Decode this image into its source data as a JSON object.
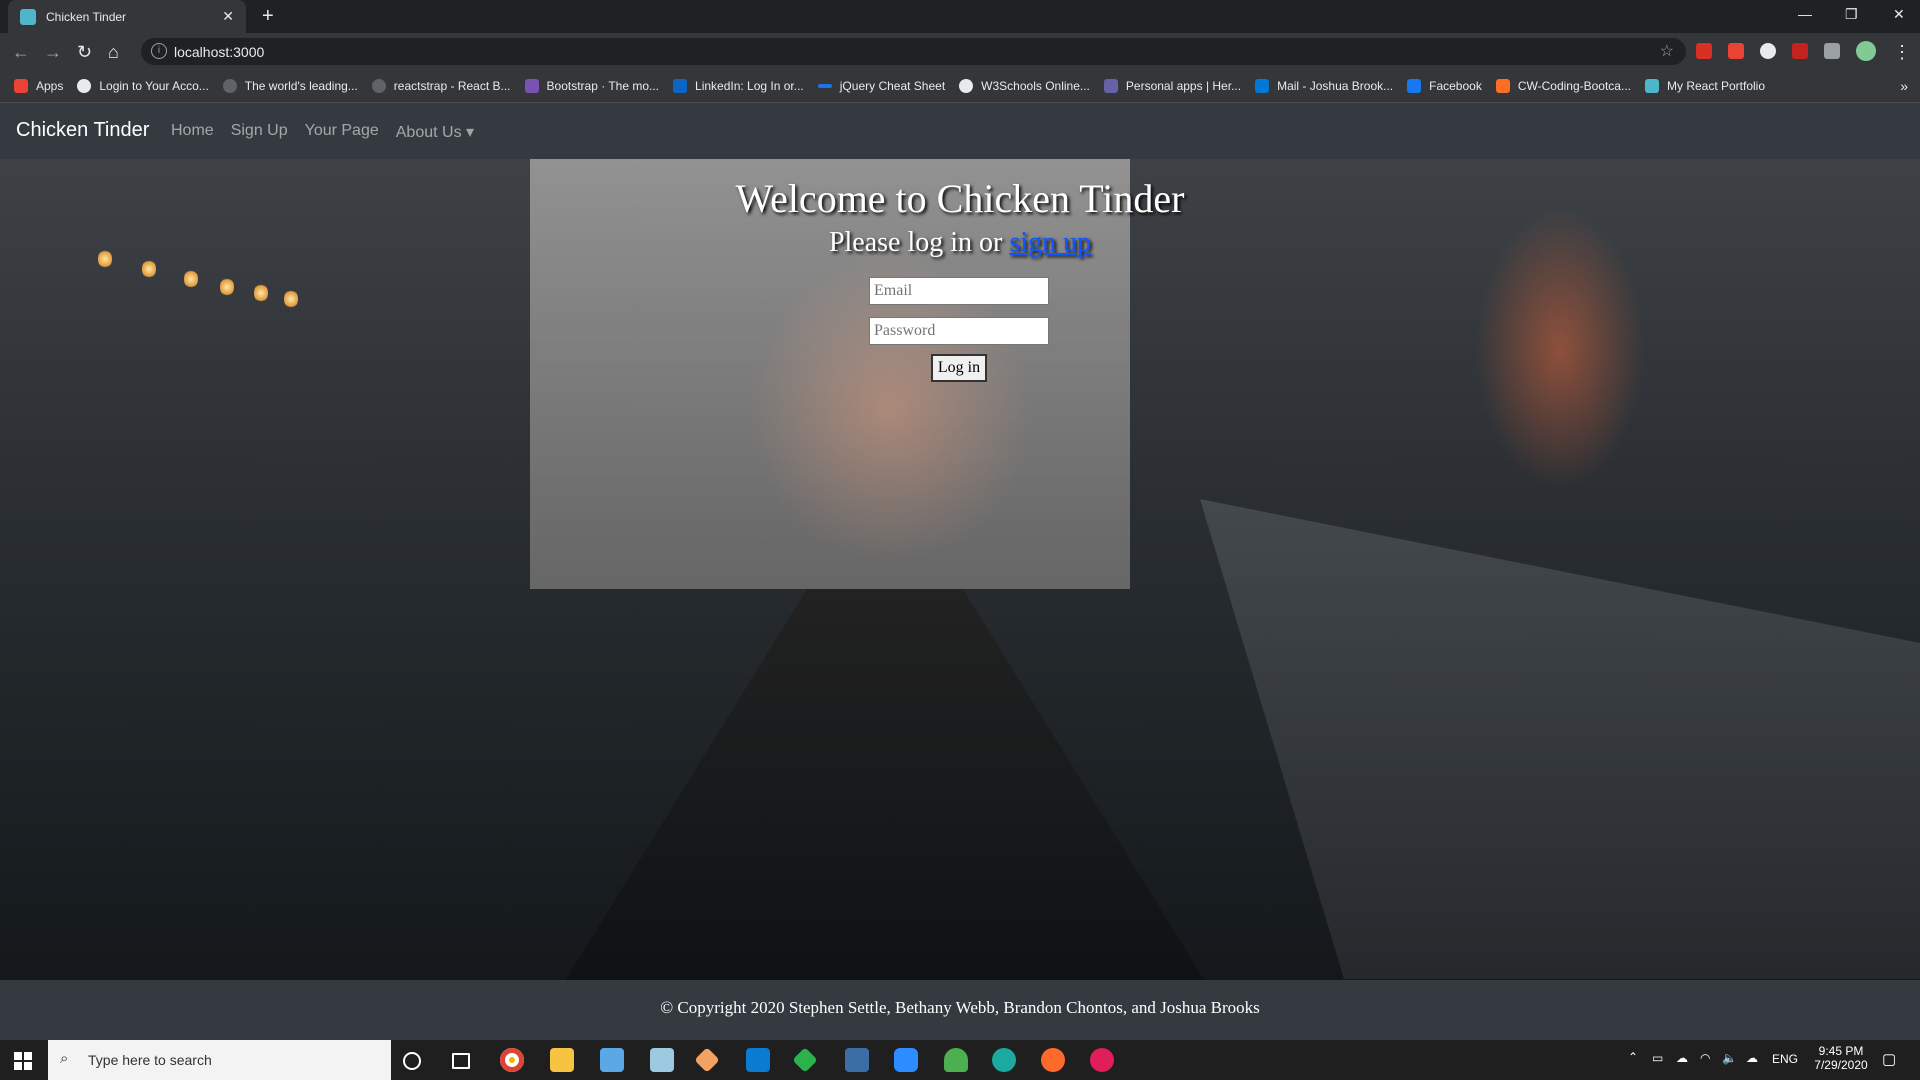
{
  "browser": {
    "tab_title": "Chicken Tinder",
    "new_tab": "+",
    "url": "localhost:3000",
    "bookmarks": [
      {
        "label": "Apps",
        "color": "#ea4335"
      },
      {
        "label": "Login to Your Acco...",
        "color": "#e8eaed"
      },
      {
        "label": "The world's leading...",
        "color": "#5f6368"
      },
      {
        "label": "reactstrap - React B...",
        "color": "#5f6368"
      },
      {
        "label": "Bootstrap · The mo...",
        "color": "#7952b3"
      },
      {
        "label": "LinkedIn: Log In or...",
        "color": "#0a66c2"
      },
      {
        "label": "jQuery Cheat Sheet",
        "color": "#1a73e8"
      },
      {
        "label": "W3Schools Online...",
        "color": "#e8eaed"
      },
      {
        "label": "Personal apps | Her...",
        "color": "#6762a6"
      },
      {
        "label": "Mail - Joshua Brook...",
        "color": "#0078d4"
      },
      {
        "label": "Facebook",
        "color": "#1877f2"
      },
      {
        "label": "CW-Coding-Bootca...",
        "color": "#fc6d26"
      },
      {
        "label": "My React Portfolio",
        "color": "#4fb6c9"
      }
    ],
    "overflow": "»"
  },
  "site_nav": {
    "brand": "Chicken Tinder",
    "links": [
      "Home",
      "Sign Up",
      "Your Page",
      "About Us ▾"
    ]
  },
  "hero": {
    "welcome": "Welcome to Chicken Tinder",
    "prompt_prefix": "Please log in or ",
    "signup_link": "sign up",
    "email_placeholder": "Email",
    "password_placeholder": "Password",
    "login_button": "Log in"
  },
  "footer": {
    "copyright": "© Copyright 2020 Stephen Settle, Bethany Webb, Brandon Chontos, and Joshua Brooks"
  },
  "taskbar": {
    "search_placeholder": "Type here to search",
    "language": "ENG",
    "time": "9:45 PM",
    "date": "7/29/2020"
  }
}
